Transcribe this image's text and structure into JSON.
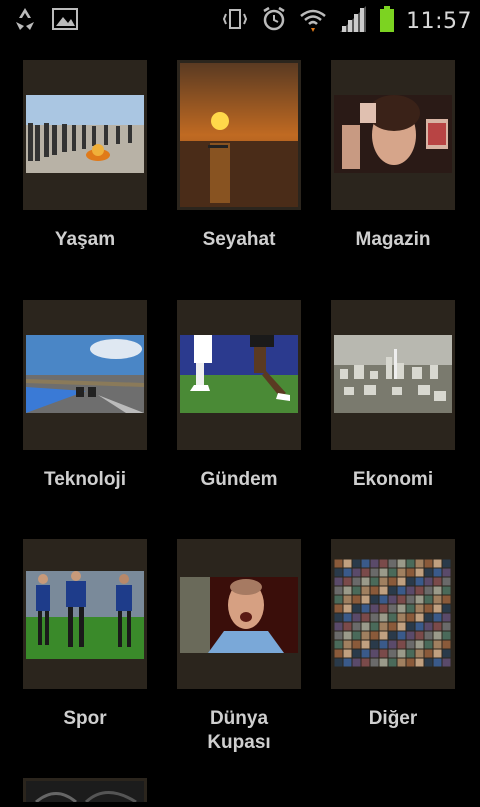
{
  "status_bar": {
    "time": "11:57",
    "left_icons": [
      "recycle-icon",
      "gallery-icon"
    ],
    "right_icons": [
      "vibrate-icon",
      "alarm-icon",
      "wifi-icon",
      "signal-icon",
      "battery-icon"
    ],
    "battery_color": "#7cd321"
  },
  "categories": [
    {
      "label": "Yaşam"
    },
    {
      "label": "Seyahat"
    },
    {
      "label": "Magazin"
    },
    {
      "label": "Teknoloji"
    },
    {
      "label": "Gündem"
    },
    {
      "label": "Ekonomi"
    },
    {
      "label": "Spor"
    },
    {
      "label": "Dünya\nKupası"
    },
    {
      "label": "Diğer"
    }
  ],
  "colors": {
    "background": "#000000",
    "tile_frame": "#2b251d",
    "label_text": "#cfcfcf"
  }
}
